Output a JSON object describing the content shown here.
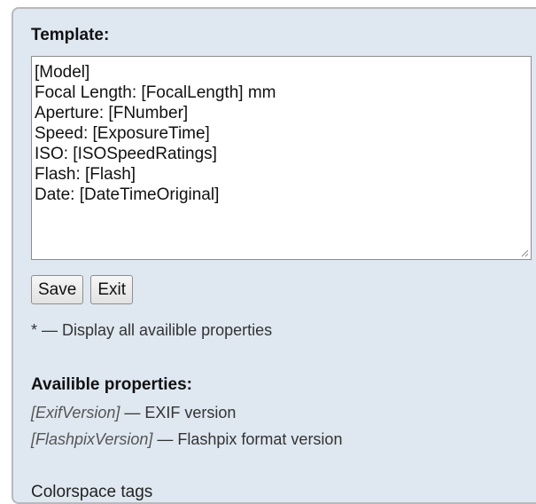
{
  "template_section": {
    "heading": "Template:",
    "lines": [
      "[Model]",
      "Focal Length: [FocalLength] mm",
      "Aperture: [FNumber]",
      "Speed: [ExposureTime]",
      "ISO: [ISOSpeedRatings]",
      "Flash: [Flash]",
      "Date: [DateTimeOriginal]"
    ]
  },
  "buttons": {
    "save_label": "Save",
    "exit_label": "Exit"
  },
  "note": "* — Display all availible properties",
  "properties": {
    "heading": "Availible properties:",
    "items": [
      {
        "tag": "[ExifVersion]",
        "description": " — EXIF version"
      },
      {
        "tag": "[FlashpixVersion]",
        "description": " — Flashpix format version"
      }
    ]
  },
  "section_label": "Colorspace tags",
  "colors": {
    "panel_background": "#dfe8f1",
    "panel_border": "#b7b9bc"
  },
  "icons": {
    "resize_grip": "resize-grip-icon"
  }
}
